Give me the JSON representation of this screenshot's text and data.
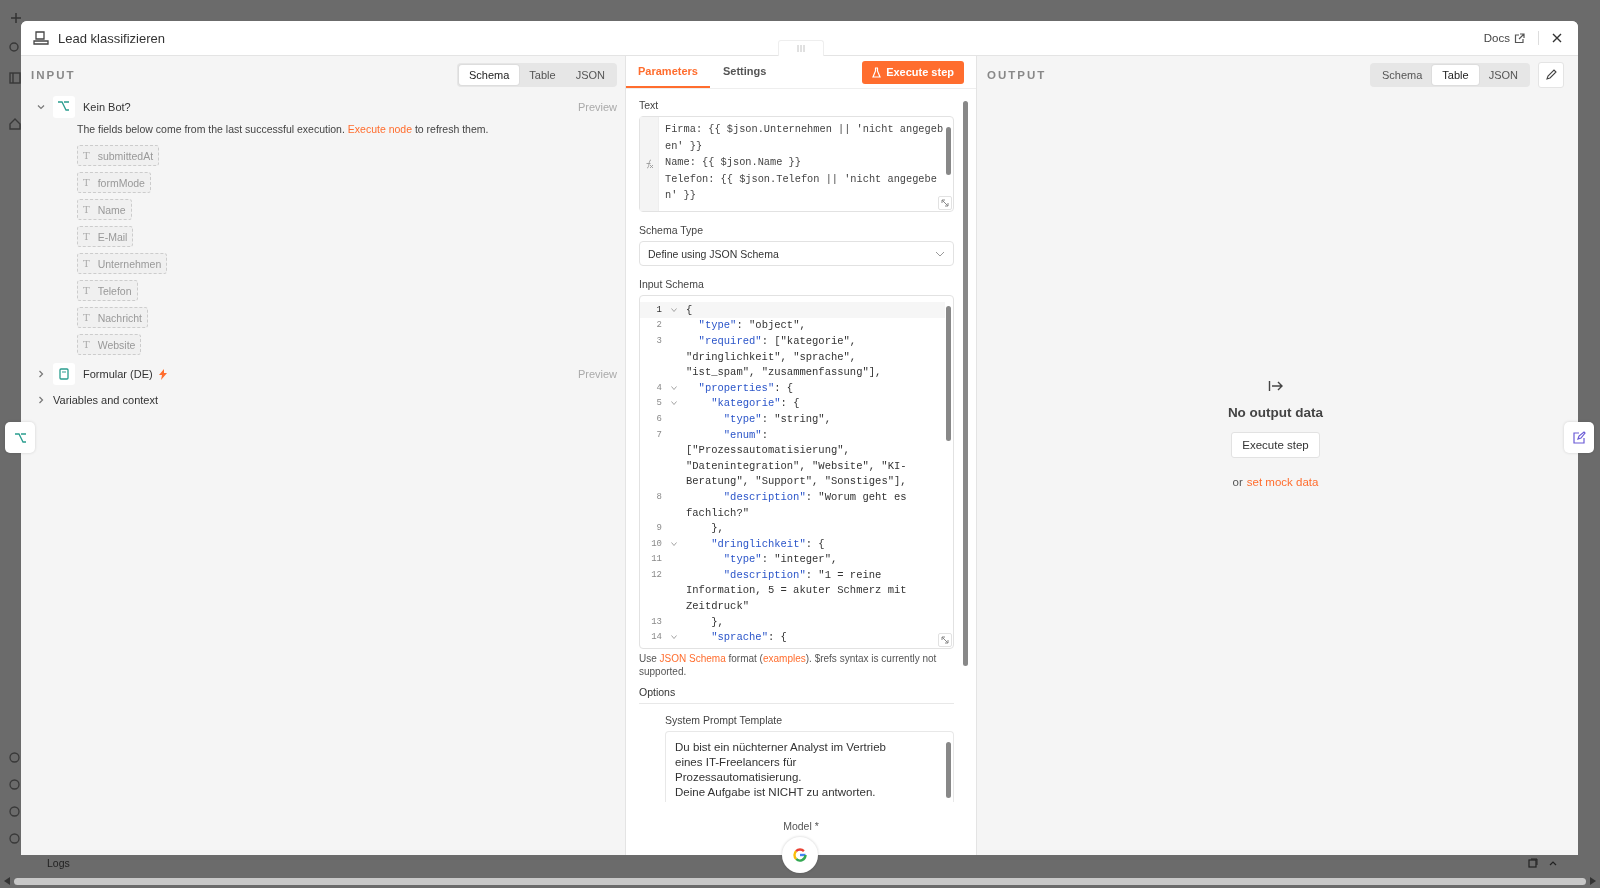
{
  "window": {
    "title": "Lead klassifizieren",
    "docs_link": "Docs"
  },
  "input": {
    "heading": "INPUT",
    "view_tabs": [
      {
        "label": "Schema",
        "selected": true
      },
      {
        "label": "Table",
        "selected": false
      },
      {
        "label": "JSON",
        "selected": false
      }
    ],
    "nodes": [
      {
        "kind": "branch",
        "label": "Kein Bot?",
        "expanded": true,
        "preview": "Preview",
        "trigger": false,
        "notice_link": "Execute node",
        "notice_after": "to refresh them.",
        "notice_before": "The fields below come from the last successful execution.",
        "fields": [
          {
            "type": "T",
            "name": "submittedAt"
          },
          {
            "type": "T",
            "name": "formMode"
          },
          {
            "type": "T",
            "name": "Name"
          },
          {
            "type": "T",
            "name": "E-Mail"
          },
          {
            "type": "T",
            "name": "Unternehmen"
          },
          {
            "type": "T",
            "name": "Telefon"
          },
          {
            "type": "T",
            "name": "Nachricht"
          },
          {
            "type": "T",
            "name": "Website"
          }
        ]
      },
      {
        "kind": "form",
        "label": "Formular (DE)",
        "expanded": false,
        "preview": "Preview",
        "trigger": true
      },
      {
        "kind": "plain",
        "label": "Variables and context",
        "expanded": false,
        "trigger": false
      }
    ]
  },
  "parameters": {
    "tabs": [
      {
        "label": "Parameters",
        "selected": true
      },
      {
        "label": "Settings",
        "selected": false
      }
    ],
    "execute_button": "Execute step",
    "text_field": {
      "label": "Text",
      "lines": [
        "Firma: {{ $json.Unternehmen || 'nicht angegeb",
        "en' }}",
        "Name: {{ $json.Name }}",
        "Telefon: {{ $json.Telefon || 'nicht angegebe",
        "n' }}"
      ]
    },
    "schema_type": {
      "label": "Schema Type",
      "value": "Define using JSON Schema"
    },
    "input_schema": {
      "label": "Input Schema",
      "lines": [
        {
          "number": "1",
          "text": "{",
          "fold": true,
          "current": true
        },
        {
          "number": "2",
          "text": "  \"type\": \"object\","
        },
        {
          "number": "3",
          "text": "  \"required\": [\"kategorie\","
        },
        {
          "text": "\"dringlichkeit\", \"sprache\","
        },
        {
          "text": "\"ist_spam\", \"zusammenfassung\"],"
        },
        {
          "number": "4",
          "text": "  \"properties\": {",
          "fold": true
        },
        {
          "number": "5",
          "text": "    \"kategorie\": {",
          "fold": true
        },
        {
          "number": "6",
          "text": "      \"type\": \"string\","
        },
        {
          "number": "7",
          "text": "      \"enum\":"
        },
        {
          "text": "[\"Prozessautomatisierung\","
        },
        {
          "text": "\"Datenintegration\", \"Website\", \"KI-"
        },
        {
          "text": "Beratung\", \"Support\", \"Sonstiges\"],"
        },
        {
          "number": "8",
          "text": "      \"description\": \"Worum geht es"
        },
        {
          "text": "fachlich?\""
        },
        {
          "number": "9",
          "text": "    },"
        },
        {
          "number": "10",
          "text": "    \"dringlichkeit\": {",
          "fold": true
        },
        {
          "number": "11",
          "text": "      \"type\": \"integer\","
        },
        {
          "number": "12",
          "text": "      \"description\": \"1 = reine"
        },
        {
          "text": "Information, 5 = akuter Schmerz mit"
        },
        {
          "text": "Zeitdruck\""
        },
        {
          "number": "13",
          "text": "    },"
        },
        {
          "number": "14",
          "text": "    \"sprache\": {",
          "fold": true
        }
      ],
      "hint_before": "Use",
      "hint_link": "JSON Schema",
      "hint_mid": "format (",
      "hint_link2": "examples",
      "hint_after": "). $refs syntax is currently not supported."
    },
    "options_heading": "Options",
    "system_prompt": {
      "label": "System Prompt Template",
      "lines": [
        "Du bist ein nüchterner Analyst im Vertrieb",
        "eines IT-Freelancers für",
        "Prozessautomatisierung.",
        "Deine Aufgabe ist NICHT zu antworten."
      ]
    },
    "model_label": "Model *"
  },
  "output": {
    "heading": "OUTPUT",
    "view_tabs": [
      {
        "label": "Schema",
        "selected": false
      },
      {
        "label": "Table",
        "selected": true
      },
      {
        "label": "JSON",
        "selected": false
      }
    ],
    "empty_title": "No output data",
    "execute_button": "Execute step",
    "mock_before": "or",
    "mock_link": "set mock data"
  },
  "logs_label": "Logs"
}
